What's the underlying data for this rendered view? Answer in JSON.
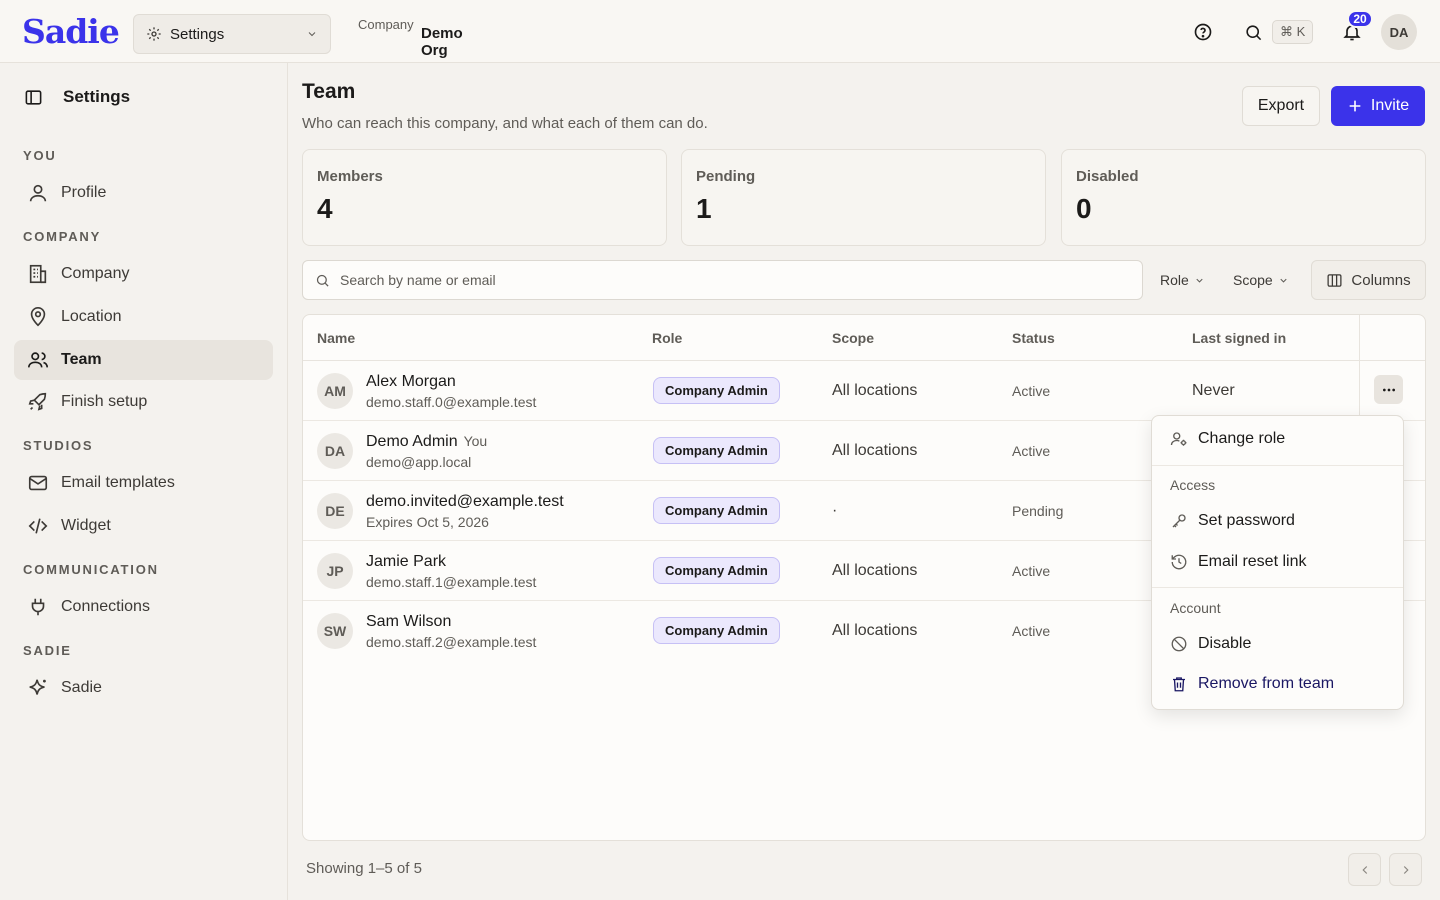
{
  "brand": {
    "name": "Sadie",
    "accent": "#3b33ea"
  },
  "topbar": {
    "workspace_select": {
      "label": "Settings",
      "icon": "gear-icon"
    },
    "org": {
      "name": "Demo Org",
      "type": "Company"
    },
    "shortcut": "⌘ K",
    "notification_count": "20",
    "user_initials": "DA"
  },
  "sidebar": {
    "title": "Settings",
    "sections": [
      {
        "label": "YOU",
        "items": [
          {
            "label": "Profile",
            "icon": "user-icon"
          }
        ]
      },
      {
        "label": "COMPANY",
        "items": [
          {
            "label": "Company",
            "icon": "building-icon"
          },
          {
            "label": "Location",
            "icon": "map-pin-icon"
          },
          {
            "label": "Team",
            "icon": "users-icon",
            "active": true
          },
          {
            "label": "Finish setup",
            "icon": "rocket-icon"
          }
        ]
      },
      {
        "label": "STUDIOS",
        "items": [
          {
            "label": "Email templates",
            "icon": "mail-icon"
          },
          {
            "label": "Widget",
            "icon": "code-icon"
          }
        ]
      },
      {
        "label": "COMMUNICATION",
        "items": [
          {
            "label": "Connections",
            "icon": "plug-icon"
          }
        ]
      },
      {
        "label": "SADIE",
        "items": [
          {
            "label": "Sadie",
            "icon": "sparkle-icon"
          }
        ]
      }
    ]
  },
  "page": {
    "title": "Team",
    "subtitle": "Who can reach this company, and what each of them can do.",
    "export_label": "Export",
    "invite_label": "Invite"
  },
  "stats": [
    {
      "label": "Members",
      "value": "4"
    },
    {
      "label": "Pending",
      "value": "1"
    },
    {
      "label": "Disabled",
      "value": "0"
    }
  ],
  "toolbar": {
    "search_placeholder": "Search by name or email",
    "role_filter": "Role",
    "scope_filter": "Scope",
    "columns_label": "Columns"
  },
  "table": {
    "headers": [
      "Name",
      "Role",
      "Scope",
      "Status",
      "Last signed in"
    ],
    "rows": [
      {
        "initials": "AM",
        "name": "Alex Morgan",
        "tag": "",
        "email": "demo.staff.0@example.test",
        "role": "Company Admin",
        "scope": "All locations",
        "status": "Active",
        "last": "Never"
      },
      {
        "initials": "DA",
        "name": "Demo Admin",
        "tag": "You",
        "email": "demo@app.local",
        "role": "Company Admin",
        "scope": "All locations",
        "status": "Active",
        "last": ""
      },
      {
        "initials": "DE",
        "name": "demo.invited@example.test",
        "tag": "",
        "email": "Expires Oct 5, 2026",
        "role": "Company Admin",
        "scope": "·",
        "status": "Pending",
        "last": ""
      },
      {
        "initials": "JP",
        "name": "Jamie Park",
        "tag": "",
        "email": "demo.staff.1@example.test",
        "role": "Company Admin",
        "scope": "All locations",
        "status": "Active",
        "last": ""
      },
      {
        "initials": "SW",
        "name": "Sam Wilson",
        "tag": "",
        "email": "demo.staff.2@example.test",
        "role": "Company Admin",
        "scope": "All locations",
        "status": "Active",
        "last": ""
      }
    ]
  },
  "row_menu": {
    "change_role": "Change role",
    "access_heading": "Access",
    "set_password": "Set password",
    "email_reset": "Email reset link",
    "account_heading": "Account",
    "disable": "Disable",
    "remove": "Remove from team"
  },
  "footer": {
    "showing": "Showing 1–5 of 5"
  }
}
